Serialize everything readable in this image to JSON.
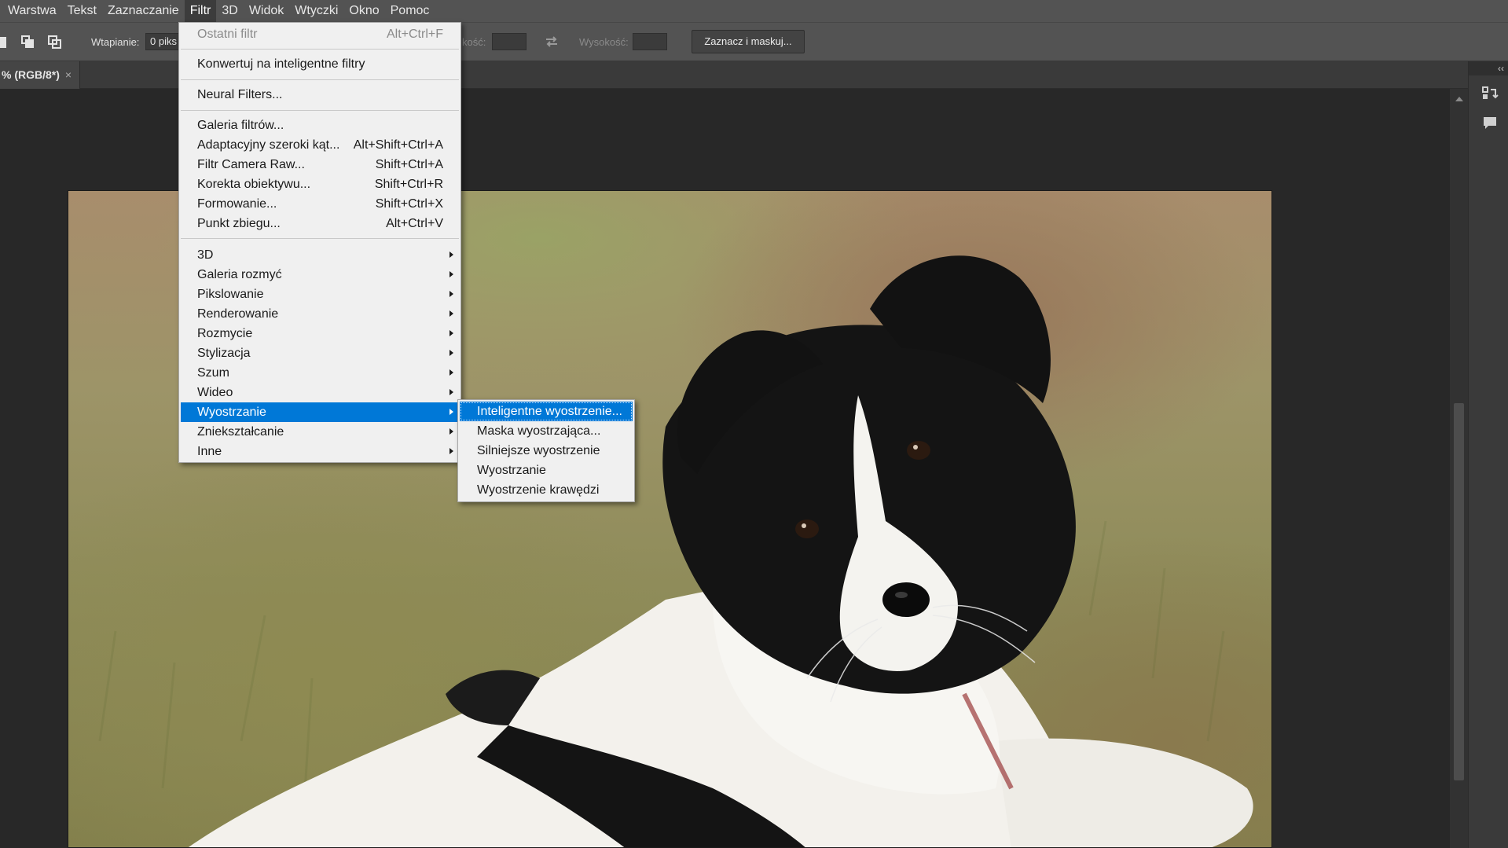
{
  "menubar": {
    "items": [
      "Warstwa",
      "Tekst",
      "Zaznaczanie",
      "Filtr",
      "3D",
      "Widok",
      "Wtyczki",
      "Okno",
      "Pomoc"
    ],
    "active_index": 3
  },
  "options": {
    "feather_label": "Wtapianie:",
    "feather_value": "0 piks",
    "width_label": "kość:",
    "height_label": "Wysokość:",
    "select_mask_button": "Zaznacz i maskuj..."
  },
  "document_tab": {
    "title": "% (RGB/8*)",
    "close": "×"
  },
  "filter_menu": {
    "items": [
      {
        "label": "Ostatni filtr",
        "shortcut": "Alt+Ctrl+F",
        "disabled": true
      },
      {
        "label": "Konwertuj na inteligentne filtry",
        "shortcut": ""
      },
      {
        "label": "Neural Filters...",
        "shortcut": ""
      },
      {
        "label": "Galeria filtrów...",
        "shortcut": ""
      },
      {
        "label": "Adaptacyjny szeroki kąt...",
        "shortcut": "Alt+Shift+Ctrl+A"
      },
      {
        "label": "Filtr Camera Raw...",
        "shortcut": "Shift+Ctrl+A"
      },
      {
        "label": "Korekta obiektywu...",
        "shortcut": "Shift+Ctrl+R"
      },
      {
        "label": "Formowanie...",
        "shortcut": "Shift+Ctrl+X"
      },
      {
        "label": "Punkt zbiegu...",
        "shortcut": "Alt+Ctrl+V"
      },
      {
        "label": "3D",
        "submenu": true
      },
      {
        "label": "Galeria rozmyć",
        "submenu": true
      },
      {
        "label": "Pikslowanie",
        "submenu": true
      },
      {
        "label": "Renderowanie",
        "submenu": true
      },
      {
        "label": "Rozmycie",
        "submenu": true
      },
      {
        "label": "Stylizacja",
        "submenu": true
      },
      {
        "label": "Szum",
        "submenu": true
      },
      {
        "label": "Wideo",
        "submenu": true
      },
      {
        "label": "Wyostrzanie",
        "submenu": true,
        "highlighted": true
      },
      {
        "label": "Zniekształcanie",
        "submenu": true
      },
      {
        "label": "Inne",
        "submenu": true
      }
    ]
  },
  "sharpen_submenu": {
    "items": [
      {
        "label": "Inteligentne wyostrzenie...",
        "highlighted": true
      },
      {
        "label": "Maska wyostrzająca..."
      },
      {
        "label": "Silniejsze wyostrzenie"
      },
      {
        "label": "Wyostrzanie"
      },
      {
        "label": "Wyostrzenie krawędzi"
      }
    ]
  },
  "colors": {
    "highlight": "#0078d7",
    "chrome": "#535353",
    "workspace": "#282828",
    "menu_bg": "#f0f0f0"
  },
  "icons": [
    "new-layer-icon",
    "subtract-selection-icon",
    "intersect-selection-icon",
    "swap-icon",
    "history-panel-icon",
    "comments-icon",
    "collapse-panels-icon"
  ]
}
